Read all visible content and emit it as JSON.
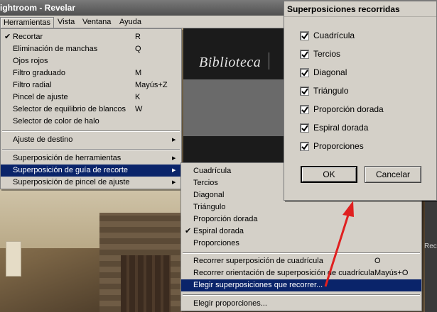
{
  "window": {
    "title": "ightroom - Revelar"
  },
  "menubar": {
    "items": [
      "Herramientas",
      "Vista",
      "Ventana",
      "Ayuda"
    ]
  },
  "background": {
    "module_label": "Biblioteca",
    "right_label": "Rec"
  },
  "tools_menu": {
    "items": [
      {
        "label": "Recortar",
        "shortcut": "R",
        "checked": true
      },
      {
        "label": "Eliminación de manchas",
        "shortcut": "Q"
      },
      {
        "label": "Ojos rojos",
        "shortcut": ""
      },
      {
        "label": "Filtro graduado",
        "shortcut": "M"
      },
      {
        "label": "Filtro radial",
        "shortcut": "Mayús+Z"
      },
      {
        "label": "Pincel de ajuste",
        "shortcut": "K"
      },
      {
        "label": "Selector de equilibrio de blancos",
        "shortcut": "W"
      },
      {
        "label": "Selector de color de halo",
        "shortcut": ""
      },
      {
        "label": "Ajuste de destino",
        "submenu": true
      },
      {
        "label": "Superposición de herramientas",
        "submenu": true
      },
      {
        "label": "Superposición de guía de recorte",
        "submenu": true,
        "highlighted": true
      },
      {
        "label": "Superposición de pincel de ajuste",
        "submenu": true
      }
    ]
  },
  "crop_submenu": {
    "items": [
      {
        "label": "Cuadrícula"
      },
      {
        "label": "Tercios"
      },
      {
        "label": "Diagonal"
      },
      {
        "label": "Triángulo"
      },
      {
        "label": "Proporción dorada"
      },
      {
        "label": "Espiral dorada",
        "checked": true
      },
      {
        "label": "Proporciones"
      },
      {
        "label": "Recorrer superposición de cuadrícula",
        "shortcut": "O"
      },
      {
        "label": "Recorrer orientación de superposición de cuadrícula",
        "shortcut": "Mayús+O"
      },
      {
        "label": "Elegir superposiciones que recorrer...",
        "highlighted": true
      },
      {
        "label": "Elegir proporciones..."
      }
    ]
  },
  "dialog": {
    "title": "Superposiciones recorridas",
    "options": [
      {
        "label": "Cuadrícula",
        "checked": true
      },
      {
        "label": "Tercios",
        "checked": true
      },
      {
        "label": "Diagonal",
        "checked": true
      },
      {
        "label": "Triángulo",
        "checked": true
      },
      {
        "label": "Proporción dorada",
        "checked": true
      },
      {
        "label": "Espiral dorada",
        "checked": true
      },
      {
        "label": "Proporciones",
        "checked": true
      }
    ],
    "ok_label": "OK",
    "cancel_label": "Cancelar"
  },
  "colors": {
    "highlight": "#0a246a",
    "menu_bg": "#d4d0c8",
    "annotation_arrow": "#e02020"
  }
}
